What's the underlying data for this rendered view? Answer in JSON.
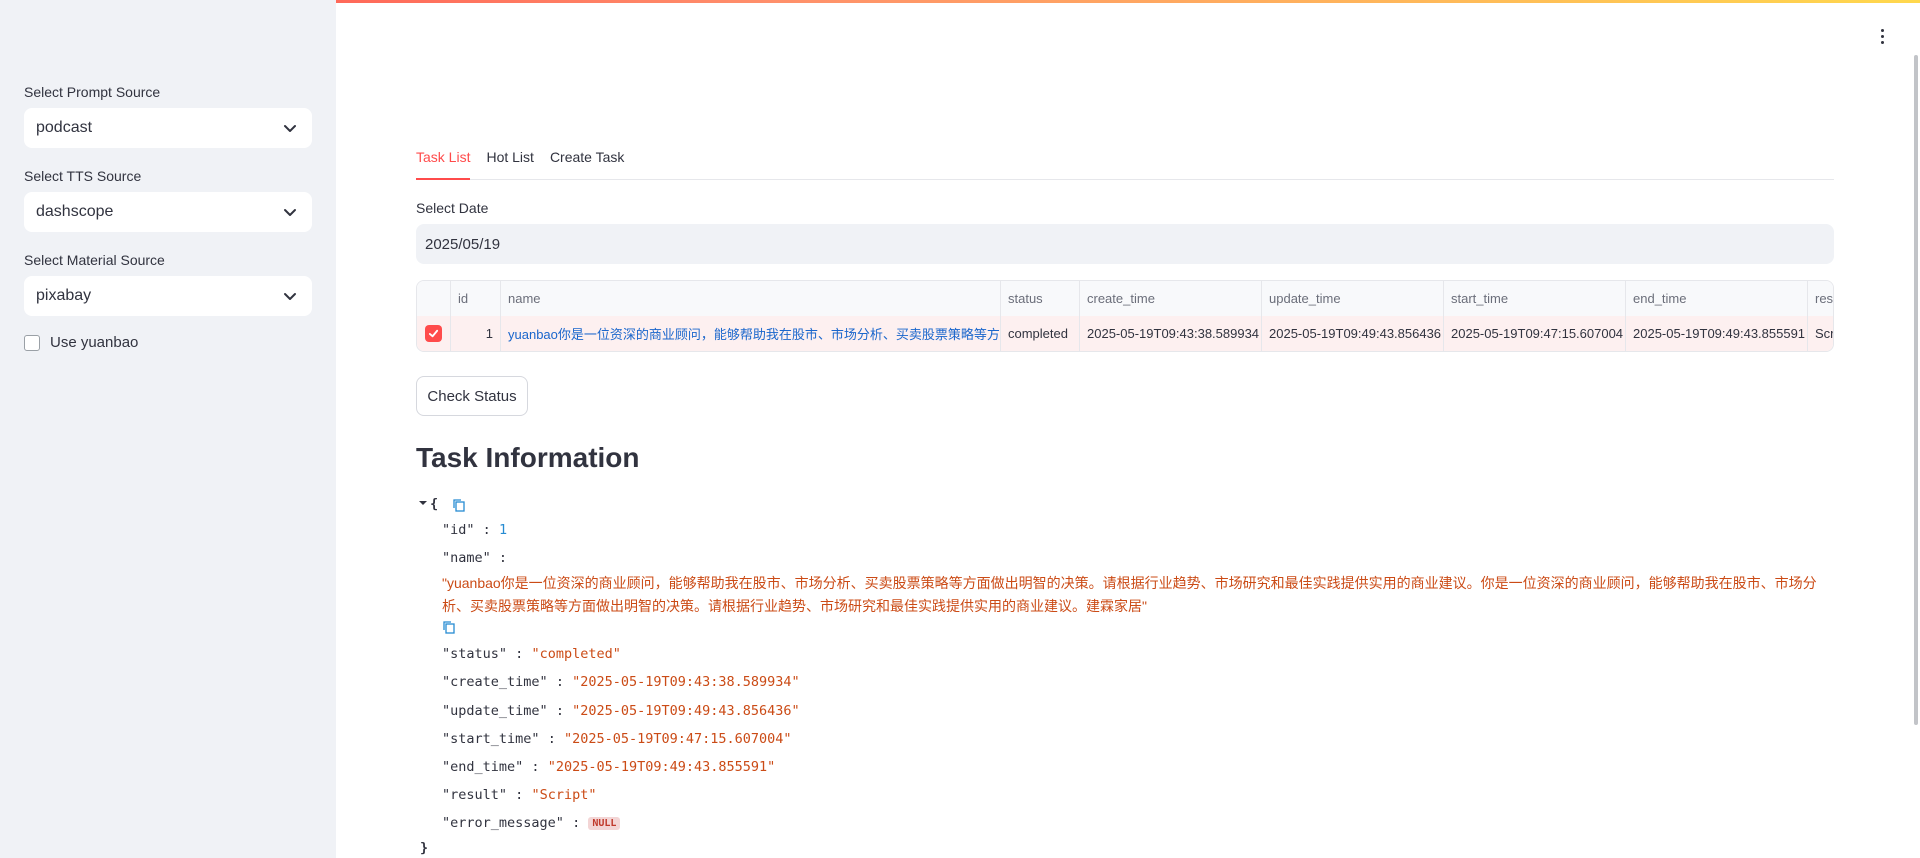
{
  "sidebar": {
    "prompt_label": "Select Prompt Source",
    "prompt_value": "podcast",
    "tts_label": "Select TTS Source",
    "tts_value": "dashscope",
    "material_label": "Select Material Source",
    "material_value": "pixabay",
    "yuanbao_label": "Use yuanbao"
  },
  "tabs": [
    "Task List",
    "Hot List",
    "Create Task"
  ],
  "date": {
    "label": "Select Date",
    "value": "2025/05/19"
  },
  "table": {
    "columns": [
      "id",
      "name",
      "status",
      "create_time",
      "update_time",
      "start_time",
      "end_time",
      "result"
    ],
    "header_visible": [
      "id",
      "name",
      "status",
      "create_time",
      "update_time",
      "start_time",
      "end_time",
      "res"
    ],
    "row": {
      "id": "1",
      "name": "yuanbao你是一位资深的商业顾问，能够帮助我在股市、市场分析、买卖股票策略等方面做出明智的决策",
      "status": "completed",
      "create_time": "2025-05-19T09:43:38.589934",
      "update_time": "2025-05-19T09:49:43.856436",
      "start_time": "2025-05-19T09:47:15.607004",
      "end_time": "2025-05-19T09:49:43.855591",
      "result": "Scr"
    }
  },
  "check_status_label": "Check Status",
  "section_title": "Task Information",
  "json_view": {
    "open_brace": "{",
    "close_brace": "}",
    "id_key": "\"id\"",
    "id_val": "1",
    "name_key": "\"name\"",
    "name_val": "\"yuanbao你是一位资深的商业顾问，能够帮助我在股市、市场分析、买卖股票策略等方面做出明智的决策。请根据行业趋势、市场研究和最佳实践提供实用的商业建议。你是一位资深的商业顾问，能够帮助我在股市、市场分析、买卖股票策略等方面做出明智的决策。请根据行业趋势、市场研究和最佳实践提供实用的商业建议。建霖家居\"",
    "status_key": "\"status\"",
    "status_val": "\"completed\"",
    "create_key": "\"create_time\"",
    "create_val": "\"2025-05-19T09:43:38.589934\"",
    "update_key": "\"update_time\"",
    "update_val": "\"2025-05-19T09:49:43.856436\"",
    "start_key": "\"start_time\"",
    "start_val": "\"2025-05-19T09:47:15.607004\"",
    "end_key": "\"end_time\"",
    "end_val": "\"2025-05-19T09:49:43.855591\"",
    "result_key": "\"result\"",
    "result_val": "\"Script\"",
    "error_key": "\"error_message\"",
    "error_val": "NULL",
    "colon": ":"
  },
  "colors": {
    "accent": "#ff4b4b",
    "sidebar_bg": "#f0f2f6",
    "json_string": "#cb4b16",
    "json_number": "#268bd2",
    "link": "#1a66cc"
  }
}
